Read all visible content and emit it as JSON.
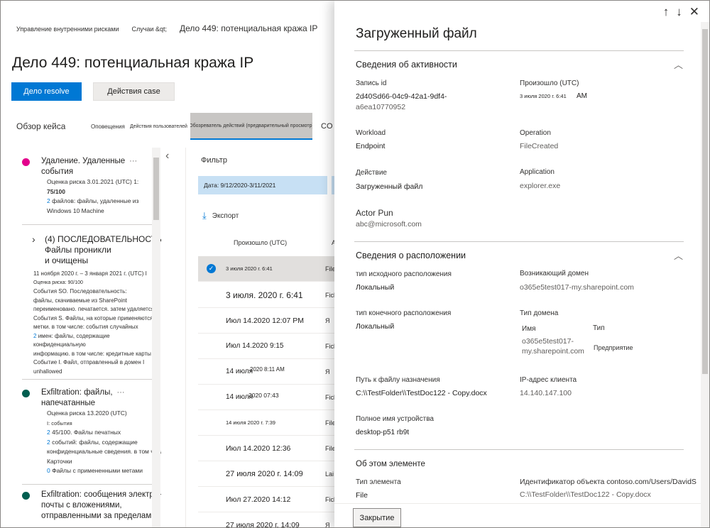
{
  "breadcrumb": {
    "root": "Управление внутренними рисками",
    "cases": "Случаи &qt;",
    "current": "Дело 449: потенциальная кража IP"
  },
  "page": {
    "title": "Дело 449: потенциальная кража IP",
    "primary_button": "Дело resolve",
    "secondary_button": "Действия case"
  },
  "tabs": {
    "overview": "Обзор кейса",
    "alerts": "Оповещения",
    "user_activity": "Действия пользователей",
    "explorer": "Обозреватель действий (предварительный просмотр)",
    "more": "CO"
  },
  "colors": {
    "accent": "#0078d4",
    "dot_pink": "#e3008c",
    "dot_teal": "#005e50"
  },
  "events": {
    "e1": {
      "title_1": "Удаление. Удаленные",
      "title_2": "события",
      "more": "···",
      "line1": "Оценка риска 3.01.2021 (UTC) 1:",
      "line2": "75/100",
      "line3_num": "2",
      "line3": "файлов: файлы, удаленные из",
      "line4": "Windows 10 Machine"
    },
    "seq": {
      "title_1": "(4) ПОСЛЕДОВАТЕЛЬНОСТЬ:",
      "title_2": "Файлы проникли",
      "title_3": "и очищены",
      "l1": "11 ноября 2020 г. – 3 января 2021 г. (UTC) I",
      "l2": "Оценка риска: 90/100",
      "l3": "События SO. Последовательность:",
      "l4": "файлы, скачиваемые из SharePoint",
      "l5": "переименовано. печатается. затем удаляется",
      "l6": "События S. Файлы, на которые применяются",
      "l7": "метки. в том числе: события случайных",
      "l8_num": "2",
      "l8": "имен: файлы, содержащие конфиденциальную",
      "l9": "информацию. в том числе: кредитные карты",
      "l10": "Событие I. Файл, отправленный в домен I",
      "l11": "unhallowed"
    },
    "e2": {
      "title_1": "Exfiltration: файлы,",
      "title_2": "напечатанные",
      "more": "···",
      "l1": "Оценка риска 13.2020 (UTC)",
      "l2": "I: события",
      "l3_num": "2",
      "l3": "45/100. Файлы печатных",
      "l4_num": "2",
      "l4": "событий: файлы, содержащие",
      "l5": "конфиденциальные сведения. в том числе: Кредит",
      "l6": "Карточки",
      "l7_num": "0",
      "l7": "Файлы с примененными метами"
    },
    "e3": {
      "title_1": "Exfiltration: сообщения электронной",
      "title_2": "почты с вложениями,",
      "title_3": "отправленными за пределами"
    }
  },
  "explorer": {
    "filter_label": "Фильтр",
    "date_filter": "Дата: 9/12/2020-3/11/2021",
    "export_label": "Экспорт",
    "col_occurred": "Произошло (UTC)",
    "col_second": "А",
    "rows": [
      {
        "date": "3 июля 2020 г. 6:41",
        "file": "File"
      },
      {
        "date": "3 июля. 2020 г. 6:41",
        "file": "Fick"
      },
      {
        "date": "Июл 14.2020 12:07 PM",
        "file": "Я"
      },
      {
        "date": "Июл 14.2020 9:15",
        "file": "Fick"
      },
      {
        "date": "14 июля",
        "date2": "2020 8:11 AM",
        "file": "Я"
      },
      {
        "date": "14 июля",
        "date2": "2020 07:43",
        "file": "Fick"
      },
      {
        "date": "14 июля 2020 г. 7:39",
        "file": "File"
      },
      {
        "date": "Июл 14.2020 12:36",
        "file": "File"
      },
      {
        "date": "27 июля 2020 г. 14:09",
        "file": "Lai"
      },
      {
        "date": "Июл 27.2020 14:12",
        "file": "Fick"
      },
      {
        "date": "27 июля 2020 г. 14:09",
        "file": "Я"
      }
    ]
  },
  "panel": {
    "title": "Загруженный файл",
    "nav_up": "↑",
    "nav_down": "↓",
    "nav_close": "✕",
    "activity": {
      "heading": "Сведения об активности",
      "record_id_label": "Запись id",
      "record_id_value_1": "2d40Sd66-04c9-42a1-9df4-",
      "record_id_value_2": "a6ea10770952",
      "occurred_label": "Произошло (UTC)",
      "occurred_value": "3 июля 2020 г. 6:41",
      "occurred_ampm": "AM",
      "workload_label": "Workload",
      "workload_value": "Endpoint",
      "operation_label": "Operation",
      "operation_value": "FileCreated",
      "action_label": "Действие",
      "action_value": "Загруженный файл",
      "application_label": "Application",
      "application_value": "explorer.exe",
      "actor_label": "Actor Pun",
      "actor_value": "abc@microsoft.com"
    },
    "location": {
      "heading": "Сведения о расположении",
      "source_type_label": "тип исходного расположения",
      "source_type_value": "Локальный",
      "origin_domain_label": "Возникающий домен",
      "origin_domain_value": "o365e5test017-my.sharepoint.com",
      "dest_type_label": "тип конечного расположения",
      "dest_type_value": "Локальный",
      "domain_type_label": "Тип домена",
      "domain_name_header": "Имя",
      "domain_type_header": "Тип",
      "domain_name_1": "o365e5test017-",
      "domain_name_2": "my.sharepoint.com",
      "domain_type_value": "Предприятие",
      "dest_path_label": "Путь к файлу назначения",
      "dest_path_value": "C:\\\\TestFolder\\\\TestDoc122 - Copy.docx",
      "client_ip_label": "IP-адрес клиента",
      "client_ip_value": "14.140.147.100",
      "device_label": "Полное имя устройства",
      "device_value": "desktop-p51 rb9t"
    },
    "about": {
      "heading": "Об этом элементе",
      "item_type_label": "Тип элемента",
      "item_type_value": "File",
      "object_id_label": "Идентификатор объекта contoso.com/Users/DavidS",
      "object_id_value": "C:\\\\TestFolder\\\\TestDoc122 - Copy.docx"
    },
    "close_button": "Закрытие"
  }
}
